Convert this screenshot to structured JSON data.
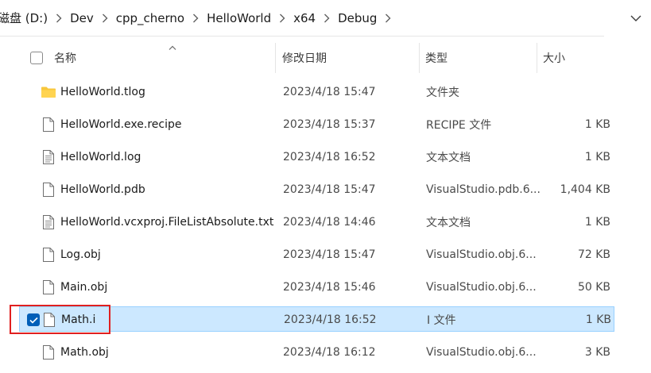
{
  "breadcrumb": {
    "items": [
      "磁盘 (D:)",
      "Dev",
      "cpp_cherno",
      "HelloWorld",
      "x64",
      "Debug"
    ]
  },
  "columns": {
    "name": "名称",
    "date": "修改日期",
    "type": "类型",
    "size": "大小"
  },
  "files": [
    {
      "icon": "folder-icon",
      "name": "HelloWorld.tlog",
      "date": "2023/4/18 15:47",
      "type": "文件夹",
      "size": ""
    },
    {
      "icon": "file-icon",
      "name": "HelloWorld.exe.recipe",
      "date": "2023/4/18 15:37",
      "type": "RECIPE 文件",
      "size": "1 KB"
    },
    {
      "icon": "text-file-icon",
      "name": "HelloWorld.log",
      "date": "2023/4/18 16:52",
      "type": "文本文档",
      "size": "1 KB"
    },
    {
      "icon": "file-icon",
      "name": "HelloWorld.pdb",
      "date": "2023/4/18 15:47",
      "type": "VisualStudio.pdb.6...",
      "size": "1,404 KB"
    },
    {
      "icon": "text-file-icon",
      "name": "HelloWorld.vcxproj.FileListAbsolute.txt",
      "date": "2023/4/18 14:46",
      "type": "文本文档",
      "size": "1 KB"
    },
    {
      "icon": "file-icon",
      "name": "Log.obj",
      "date": "2023/4/18 15:47",
      "type": "VisualStudio.obj.6...",
      "size": "72 KB"
    },
    {
      "icon": "file-icon",
      "name": "Main.obj",
      "date": "2023/4/18 15:46",
      "type": "VisualStudio.obj.6...",
      "size": "50 KB"
    },
    {
      "icon": "file-icon",
      "name": "Math.i",
      "date": "2023/4/18 16:52",
      "type": "I 文件",
      "size": "1 KB",
      "selected": true
    },
    {
      "icon": "file-icon",
      "name": "Math.obj",
      "date": "2023/4/18 16:12",
      "type": "VisualStudio.obj.6...",
      "size": "3 KB"
    }
  ],
  "colors": {
    "selection_bg": "#cce8ff",
    "selection_border": "#99d1ff",
    "checkbox_accent": "#005fb8",
    "annotation_red": "#e02020",
    "folder_yellow": "#f8c73c"
  }
}
